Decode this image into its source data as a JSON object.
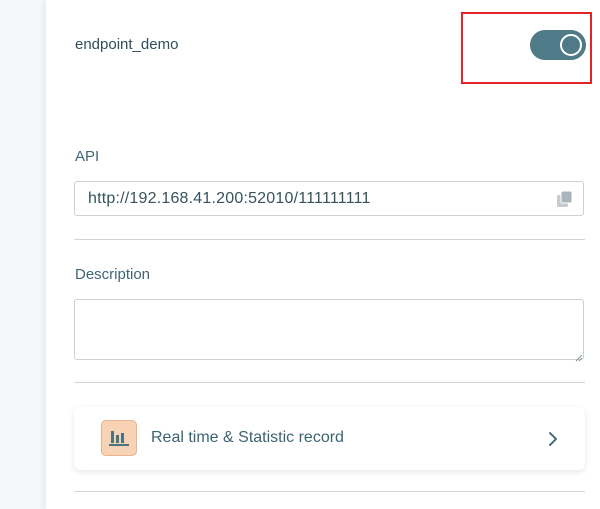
{
  "endpoint": {
    "name": "endpoint_demo",
    "enabled": true
  },
  "api": {
    "label": "API",
    "value": "http://192.168.41.200:52010/111111111"
  },
  "description": {
    "label": "Description",
    "value": ""
  },
  "stats_card": {
    "label": "Real time & Statistic record"
  },
  "colors": {
    "toggle_on": "#4f7a87",
    "highlight": "#e3232b",
    "label": "#3f6675",
    "icon_bg": "#f7d2b4"
  },
  "icons": {
    "copy": "copy-icon",
    "stats": "bar-chart-icon",
    "chevron": "chevron-right-icon"
  }
}
